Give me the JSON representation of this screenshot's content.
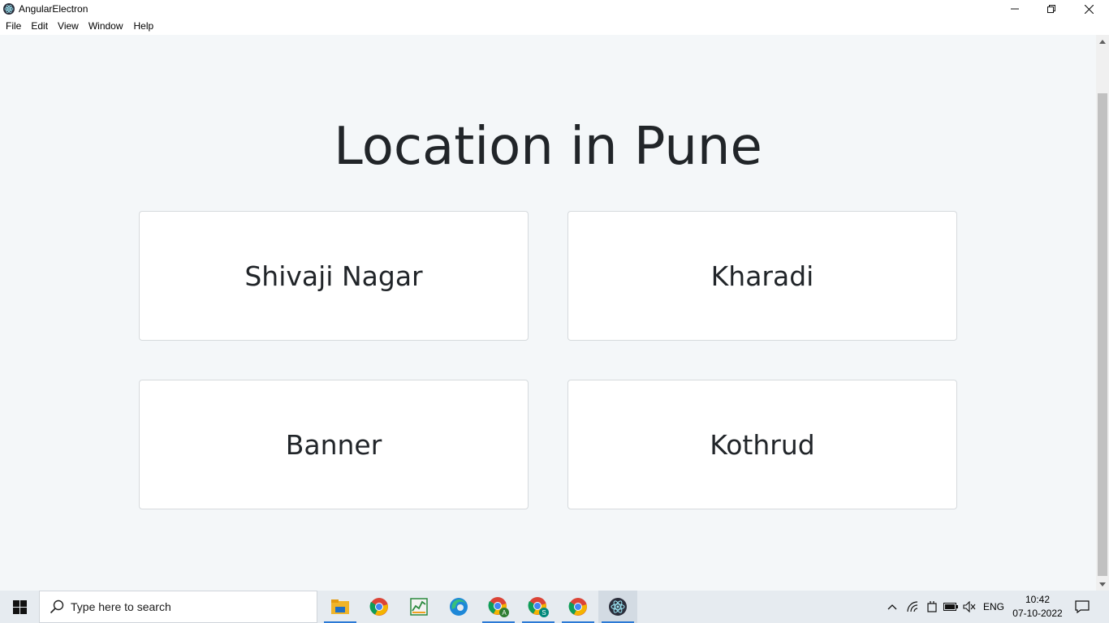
{
  "window": {
    "title": "AngularElectron"
  },
  "menu": {
    "items": [
      "File",
      "Edit",
      "View",
      "Window",
      "Help"
    ]
  },
  "page": {
    "title": "Location in Pune",
    "locations": [
      "Shivaji Nagar",
      "Kharadi",
      "Banner",
      "Kothrud"
    ]
  },
  "taskbar": {
    "search_placeholder": "Type here to search",
    "apps": [
      "file-explorer-icon",
      "chrome-icon",
      "task-manager-icon",
      "edge-icon",
      "chrome-profile-a-icon",
      "chrome-profile-s-icon",
      "chrome-icon",
      "electron-icon"
    ],
    "language": "ENG",
    "time": "10:42",
    "date": "07-10-2022"
  },
  "colors": {
    "content_bg": "#f4f7f9",
    "card_border": "#d6dadd",
    "text": "#212529",
    "taskbar_bg": "#e6ebf0",
    "taskbar_accent": "#2c7ad6"
  }
}
